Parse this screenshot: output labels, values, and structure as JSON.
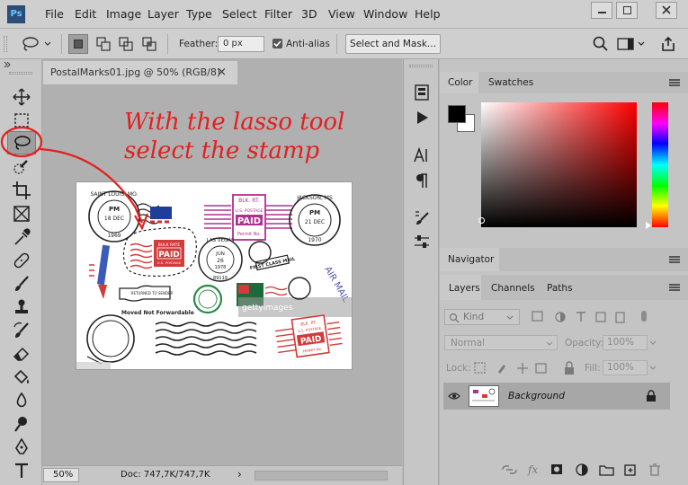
{
  "app": {
    "logo": "Ps"
  },
  "menu": [
    "File",
    "Edit",
    "Image",
    "Layer",
    "Type",
    "Select",
    "Filter",
    "3D",
    "View",
    "Window",
    "Help"
  ],
  "options": {
    "feather_label": "Feather:",
    "feather_value": "0 px",
    "antialias_label": "Anti-alias",
    "antialias_checked": true,
    "select_mask_label": "Select and Mask..."
  },
  "document": {
    "tab_title": "PostalMarks01.jpg @ 50% (RGB/8)",
    "tab_close": "×",
    "zoom": "50%",
    "doc_info": "Doc: 747,7K/747,7K",
    "status_arrow": "›"
  },
  "annotation": {
    "line1": "With the lasso tool",
    "line2": "select the stamp",
    "color": "#e32020"
  },
  "stamps": {
    "saint_louis": {
      "top": "SAINT LOUIS, MO.",
      "date1": "PM",
      "date2": "18 DEC",
      "year": "1969"
    },
    "mark_paid_1": {
      "top": "BLK. RT.",
      "mid": "U.S. POSTAGE",
      "big": "PAID",
      "bottom": "Permit No."
    },
    "jackson": {
      "top": "JACKSON, MS",
      "date1": "PM",
      "date2": "21 DEC",
      "year": "1970"
    },
    "las_vegas": {
      "top": "LAS VEGAS",
      "mid1": "JUN",
      "mid2": "26",
      "mid3": "1978",
      "bottom": "89119"
    },
    "first_class": "FIRST CLASS MAIL",
    "air_mail": "AIR MAIL",
    "returned": "RETURNED TO SENDER",
    "moved": "Moved Not Forwardable",
    "paid_red": {
      "top": "BULK RATE",
      "big": "PAID",
      "bottom": "U.S. POSTAGE"
    },
    "paid_right": {
      "top": "BLK. RT.",
      "mid": "U.S. POSTAGE",
      "big": "PAID",
      "bottom": "PERMIT No."
    },
    "watermark": "gettyimages"
  },
  "panels": {
    "color_tab": "Color",
    "swatches_tab": "Swatches",
    "navigator_tab": "Navigator",
    "layers_tab": "Layers",
    "channels_tab": "Channels",
    "paths_tab": "Paths",
    "kind_label": "Kind",
    "blend_mode": "Normal",
    "opacity_label": "Opacity:",
    "opacity_value": "100%",
    "lock_label": "Lock:",
    "fill_label": "Fill:",
    "fill_value": "100%",
    "layer_name": "Background"
  },
  "colors": {
    "foreground": "#000000",
    "background": "#ffffff",
    "accent_red": "#e32020",
    "panel_bg": "#c4c4c4"
  }
}
